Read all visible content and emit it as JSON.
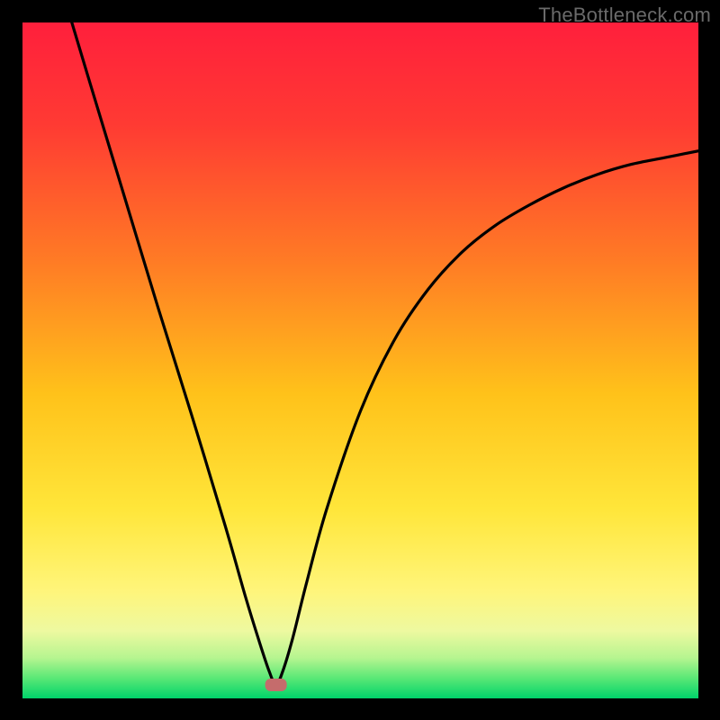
{
  "watermark": "TheBottleneck.com",
  "chart_data": {
    "type": "line",
    "title": "",
    "xlabel": "",
    "ylabel": "",
    "xlim": [
      0,
      100
    ],
    "ylim": [
      0,
      100
    ],
    "grid": false,
    "legend": false,
    "annotations": [
      {
        "type": "marker",
        "shape": "rounded-rect",
        "color": "#c56c6c",
        "x": 37.5,
        "y": 2
      }
    ],
    "series": [
      {
        "name": "bottleneck-curve",
        "color": "#000000",
        "x": [
          7.3,
          10,
          15,
          20,
          25,
          30,
          33,
          35,
          36.5,
          37.5,
          38.5,
          40,
          42,
          45,
          50,
          55,
          60,
          65,
          70,
          75,
          80,
          85,
          90,
          95,
          100
        ],
        "y": [
          100,
          91,
          74.5,
          58,
          42,
          25.5,
          15,
          8.5,
          4,
          2,
          4,
          9,
          17,
          28,
          42.5,
          53,
          60.5,
          66,
          70,
          73,
          75.5,
          77.5,
          79,
          80,
          81
        ]
      }
    ],
    "background_gradient": {
      "stops": [
        {
          "offset": 0.0,
          "color": "#ff1f3c"
        },
        {
          "offset": 0.15,
          "color": "#ff3a33"
        },
        {
          "offset": 0.35,
          "color": "#ff7a25"
        },
        {
          "offset": 0.55,
          "color": "#ffc21a"
        },
        {
          "offset": 0.72,
          "color": "#ffe63a"
        },
        {
          "offset": 0.84,
          "color": "#fff57a"
        },
        {
          "offset": 0.9,
          "color": "#eef9a0"
        },
        {
          "offset": 0.94,
          "color": "#b6f590"
        },
        {
          "offset": 0.97,
          "color": "#5ae876"
        },
        {
          "offset": 1.0,
          "color": "#00d36a"
        }
      ]
    }
  }
}
